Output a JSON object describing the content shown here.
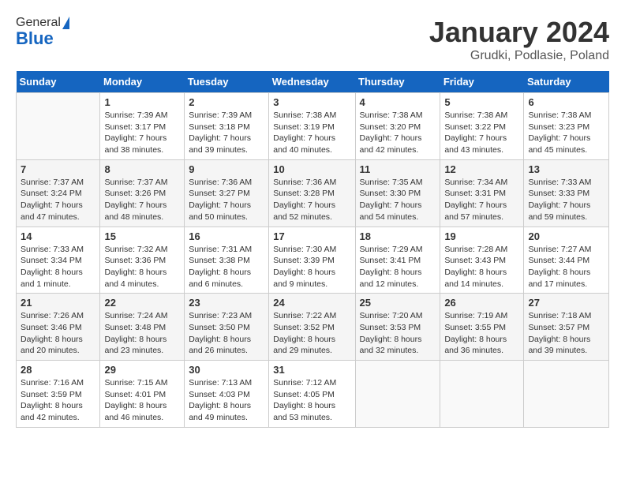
{
  "logo": {
    "general": "General",
    "blue": "Blue"
  },
  "title": "January 2024",
  "subtitle": "Grudki, Podlasie, Poland",
  "days_of_week": [
    "Sunday",
    "Monday",
    "Tuesday",
    "Wednesday",
    "Thursday",
    "Friday",
    "Saturday"
  ],
  "weeks": [
    [
      {
        "day": "",
        "sunrise": "",
        "sunset": "",
        "daylight": ""
      },
      {
        "day": "1",
        "sunrise": "Sunrise: 7:39 AM",
        "sunset": "Sunset: 3:17 PM",
        "daylight": "Daylight: 7 hours and 38 minutes."
      },
      {
        "day": "2",
        "sunrise": "Sunrise: 7:39 AM",
        "sunset": "Sunset: 3:18 PM",
        "daylight": "Daylight: 7 hours and 39 minutes."
      },
      {
        "day": "3",
        "sunrise": "Sunrise: 7:38 AM",
        "sunset": "Sunset: 3:19 PM",
        "daylight": "Daylight: 7 hours and 40 minutes."
      },
      {
        "day": "4",
        "sunrise": "Sunrise: 7:38 AM",
        "sunset": "Sunset: 3:20 PM",
        "daylight": "Daylight: 7 hours and 42 minutes."
      },
      {
        "day": "5",
        "sunrise": "Sunrise: 7:38 AM",
        "sunset": "Sunset: 3:22 PM",
        "daylight": "Daylight: 7 hours and 43 minutes."
      },
      {
        "day": "6",
        "sunrise": "Sunrise: 7:38 AM",
        "sunset": "Sunset: 3:23 PM",
        "daylight": "Daylight: 7 hours and 45 minutes."
      }
    ],
    [
      {
        "day": "7",
        "sunrise": "Sunrise: 7:37 AM",
        "sunset": "Sunset: 3:24 PM",
        "daylight": "Daylight: 7 hours and 47 minutes."
      },
      {
        "day": "8",
        "sunrise": "Sunrise: 7:37 AM",
        "sunset": "Sunset: 3:26 PM",
        "daylight": "Daylight: 7 hours and 48 minutes."
      },
      {
        "day": "9",
        "sunrise": "Sunrise: 7:36 AM",
        "sunset": "Sunset: 3:27 PM",
        "daylight": "Daylight: 7 hours and 50 minutes."
      },
      {
        "day": "10",
        "sunrise": "Sunrise: 7:36 AM",
        "sunset": "Sunset: 3:28 PM",
        "daylight": "Daylight: 7 hours and 52 minutes."
      },
      {
        "day": "11",
        "sunrise": "Sunrise: 7:35 AM",
        "sunset": "Sunset: 3:30 PM",
        "daylight": "Daylight: 7 hours and 54 minutes."
      },
      {
        "day": "12",
        "sunrise": "Sunrise: 7:34 AM",
        "sunset": "Sunset: 3:31 PM",
        "daylight": "Daylight: 7 hours and 57 minutes."
      },
      {
        "day": "13",
        "sunrise": "Sunrise: 7:33 AM",
        "sunset": "Sunset: 3:33 PM",
        "daylight": "Daylight: 7 hours and 59 minutes."
      }
    ],
    [
      {
        "day": "14",
        "sunrise": "Sunrise: 7:33 AM",
        "sunset": "Sunset: 3:34 PM",
        "daylight": "Daylight: 8 hours and 1 minute."
      },
      {
        "day": "15",
        "sunrise": "Sunrise: 7:32 AM",
        "sunset": "Sunset: 3:36 PM",
        "daylight": "Daylight: 8 hours and 4 minutes."
      },
      {
        "day": "16",
        "sunrise": "Sunrise: 7:31 AM",
        "sunset": "Sunset: 3:38 PM",
        "daylight": "Daylight: 8 hours and 6 minutes."
      },
      {
        "day": "17",
        "sunrise": "Sunrise: 7:30 AM",
        "sunset": "Sunset: 3:39 PM",
        "daylight": "Daylight: 8 hours and 9 minutes."
      },
      {
        "day": "18",
        "sunrise": "Sunrise: 7:29 AM",
        "sunset": "Sunset: 3:41 PM",
        "daylight": "Daylight: 8 hours and 12 minutes."
      },
      {
        "day": "19",
        "sunrise": "Sunrise: 7:28 AM",
        "sunset": "Sunset: 3:43 PM",
        "daylight": "Daylight: 8 hours and 14 minutes."
      },
      {
        "day": "20",
        "sunrise": "Sunrise: 7:27 AM",
        "sunset": "Sunset: 3:44 PM",
        "daylight": "Daylight: 8 hours and 17 minutes."
      }
    ],
    [
      {
        "day": "21",
        "sunrise": "Sunrise: 7:26 AM",
        "sunset": "Sunset: 3:46 PM",
        "daylight": "Daylight: 8 hours and 20 minutes."
      },
      {
        "day": "22",
        "sunrise": "Sunrise: 7:24 AM",
        "sunset": "Sunset: 3:48 PM",
        "daylight": "Daylight: 8 hours and 23 minutes."
      },
      {
        "day": "23",
        "sunrise": "Sunrise: 7:23 AM",
        "sunset": "Sunset: 3:50 PM",
        "daylight": "Daylight: 8 hours and 26 minutes."
      },
      {
        "day": "24",
        "sunrise": "Sunrise: 7:22 AM",
        "sunset": "Sunset: 3:52 PM",
        "daylight": "Daylight: 8 hours and 29 minutes."
      },
      {
        "day": "25",
        "sunrise": "Sunrise: 7:20 AM",
        "sunset": "Sunset: 3:53 PM",
        "daylight": "Daylight: 8 hours and 32 minutes."
      },
      {
        "day": "26",
        "sunrise": "Sunrise: 7:19 AM",
        "sunset": "Sunset: 3:55 PM",
        "daylight": "Daylight: 8 hours and 36 minutes."
      },
      {
        "day": "27",
        "sunrise": "Sunrise: 7:18 AM",
        "sunset": "Sunset: 3:57 PM",
        "daylight": "Daylight: 8 hours and 39 minutes."
      }
    ],
    [
      {
        "day": "28",
        "sunrise": "Sunrise: 7:16 AM",
        "sunset": "Sunset: 3:59 PM",
        "daylight": "Daylight: 8 hours and 42 minutes."
      },
      {
        "day": "29",
        "sunrise": "Sunrise: 7:15 AM",
        "sunset": "Sunset: 4:01 PM",
        "daylight": "Daylight: 8 hours and 46 minutes."
      },
      {
        "day": "30",
        "sunrise": "Sunrise: 7:13 AM",
        "sunset": "Sunset: 4:03 PM",
        "daylight": "Daylight: 8 hours and 49 minutes."
      },
      {
        "day": "31",
        "sunrise": "Sunrise: 7:12 AM",
        "sunset": "Sunset: 4:05 PM",
        "daylight": "Daylight: 8 hours and 53 minutes."
      },
      {
        "day": "",
        "sunrise": "",
        "sunset": "",
        "daylight": ""
      },
      {
        "day": "",
        "sunrise": "",
        "sunset": "",
        "daylight": ""
      },
      {
        "day": "",
        "sunrise": "",
        "sunset": "",
        "daylight": ""
      }
    ]
  ]
}
